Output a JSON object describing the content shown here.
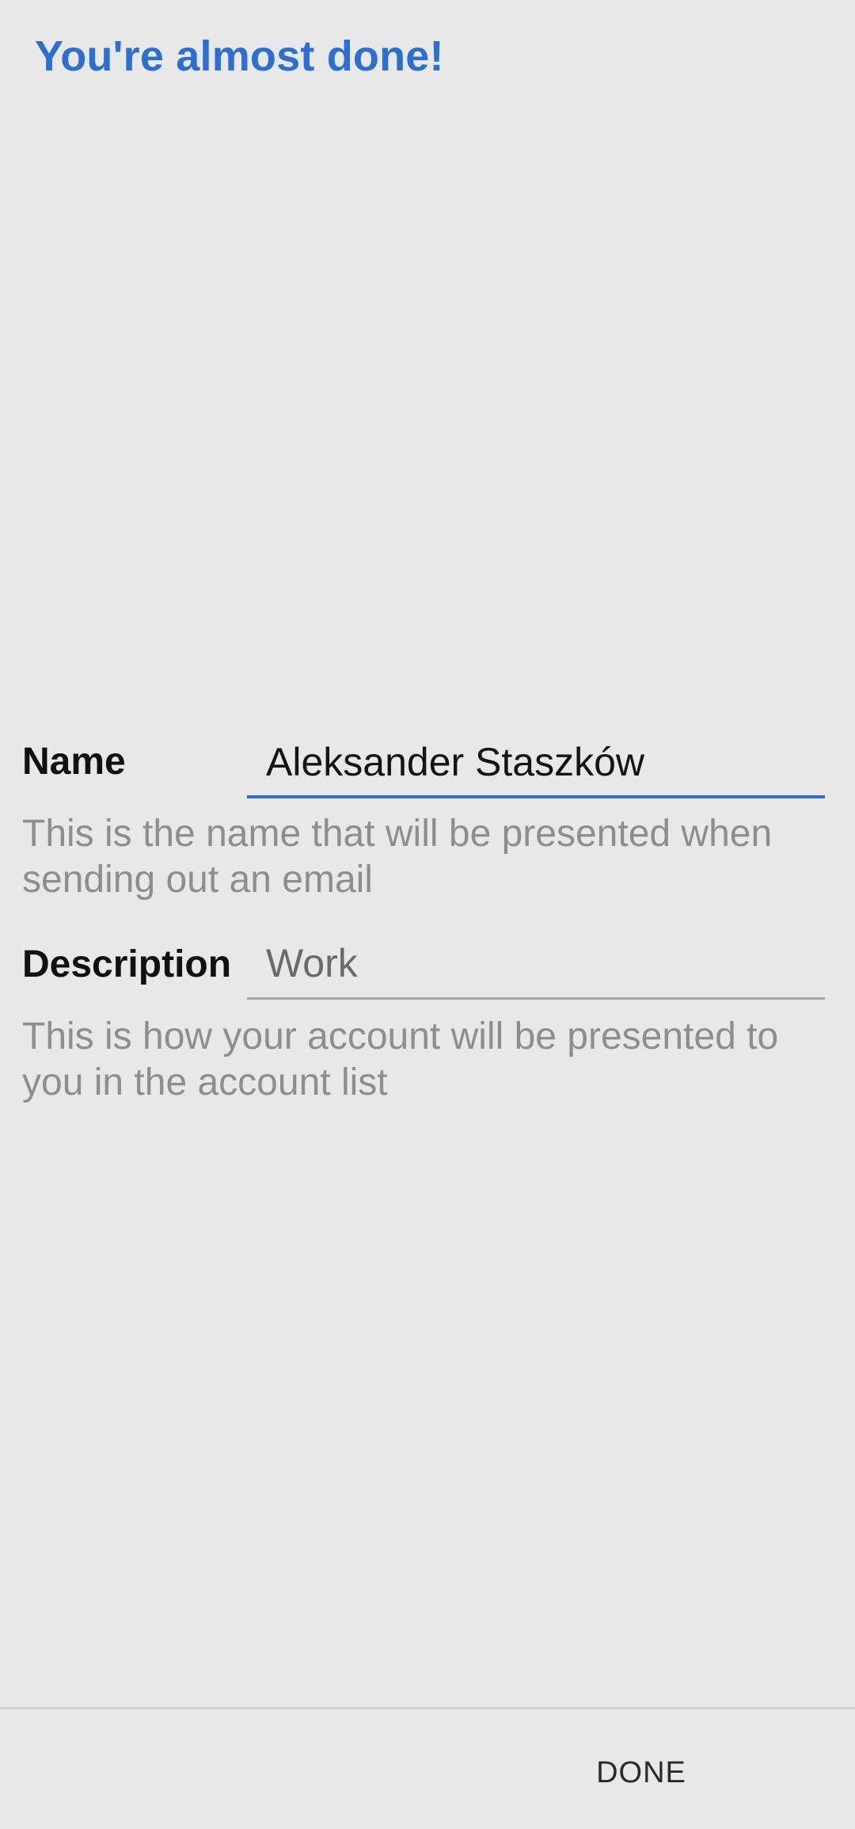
{
  "header": {
    "title": "You're almost done!"
  },
  "form": {
    "name": {
      "label": "Name",
      "value": "Aleksander Staszków",
      "hint": "This is the name that will be presented when sending out an email"
    },
    "description": {
      "label": "Description",
      "placeholder": "Work",
      "value": "",
      "hint": "This is how your account will be presented to you in the account list"
    }
  },
  "footer": {
    "done_label": "DONE"
  },
  "colors": {
    "accent": "#2a6fd1",
    "background": "#e8e8e9",
    "hint_text": "#8e8e8e"
  }
}
